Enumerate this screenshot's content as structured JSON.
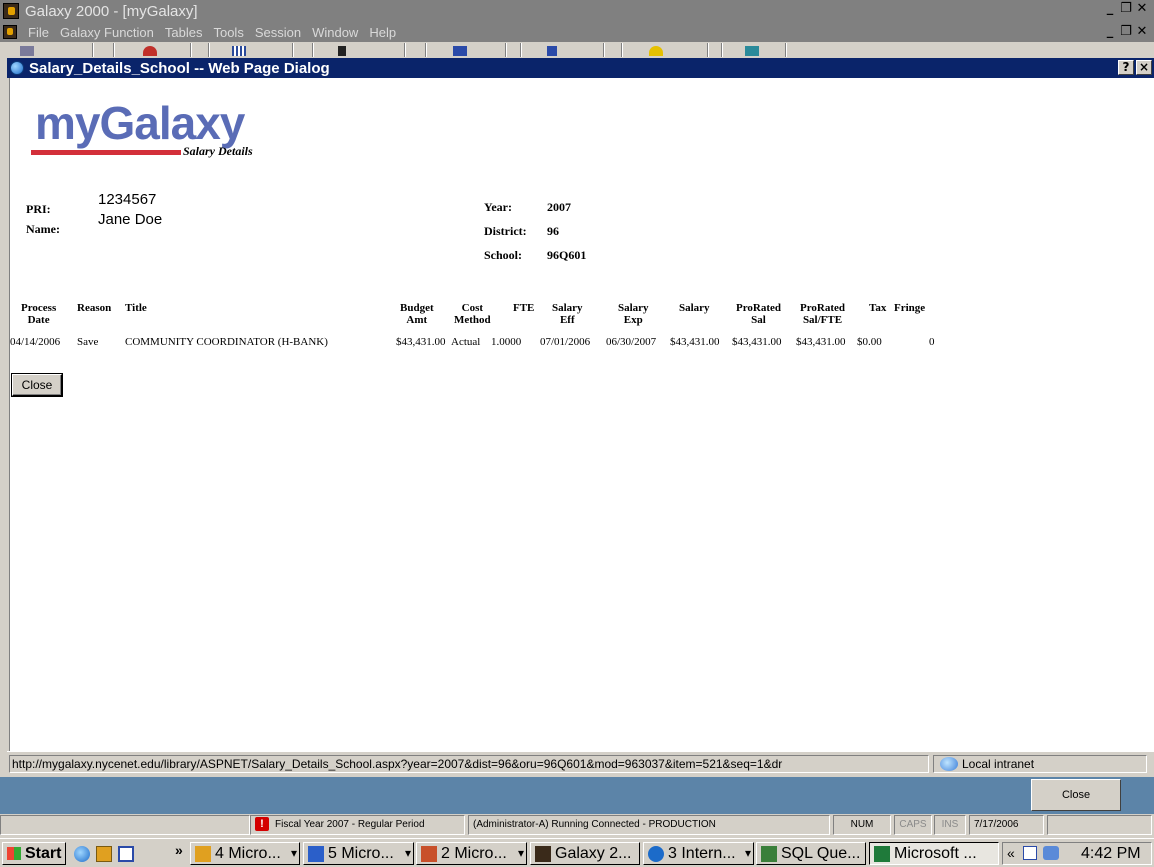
{
  "app": {
    "title": "Galaxy 2000 - [myGalaxy]",
    "menu": [
      "File",
      "Galaxy Function",
      "Tables",
      "Tools",
      "Session",
      "Window",
      "Help"
    ]
  },
  "dialog": {
    "title": "Salary_Details_School -- Web Page Dialog",
    "help_btn": "?",
    "close_btn": "×"
  },
  "logo": {
    "text": "myGalaxy",
    "subtitle": "Salary Details"
  },
  "info": {
    "pri_label": "PRI:",
    "pri_value": "1234567",
    "name_label": "Name:",
    "name_value": "Jane Doe",
    "year_label": "Year:",
    "year_value": "2007",
    "district_label": "District:",
    "district_value": "96",
    "school_label": "School:",
    "school_value": "96Q601"
  },
  "table": {
    "headers": {
      "process_date": "Process\nDate",
      "reason": "Reason",
      "title": "Title",
      "budget_amt": "Budget\nAmt",
      "cost_method": "Cost\nMethod",
      "fte": "FTE",
      "salary_eff": "Salary\nEff",
      "salary_exp": "Salary\nExp",
      "salary": "Salary",
      "prorated_sal": "ProRated\nSal",
      "prorated_sal_fte": "ProRated\nSal/FTE",
      "tax": "Tax",
      "fringe": "Fringe"
    },
    "rows": [
      {
        "process_date": "04/14/2006",
        "reason": "Save",
        "title": "COMMUNITY COORDINATOR (H-BANK)",
        "budget_amt": "$43,431.00",
        "cost_method": "Actual",
        "fte": "1.0000",
        "salary_eff": "07/01/2006",
        "salary_exp": "06/30/2007",
        "salary": "$43,431.00",
        "prorated_sal": "$43,431.00",
        "prorated_sal_fte": "$43,431.00",
        "tax": "$0.00",
        "fringe": "0"
      }
    ]
  },
  "close_button": "Close",
  "ie_status": {
    "url": "http://mygalaxy.nycenet.edu/library/ASPNET/Salary_Details_School.aspx?year=2007&dist=96&oru=96Q601&mod=963037&item=521&seq=1&dr",
    "zone": "Local intranet"
  },
  "galaxy_close": "Close",
  "app_status": {
    "fiscal": "Fiscal Year 2007 - Regular Period",
    "connection": "(Administrator-A) Running Connected - PRODUCTION",
    "num": "NUM",
    "caps": "CAPS",
    "ins": "INS",
    "date": "7/17/2006"
  },
  "taskbar": {
    "start": "Start",
    "chevron": "»",
    "tasks": [
      {
        "label": "4 Micro...",
        "icon": "outlook-icon",
        "color": "#e0a020",
        "dropdown": true
      },
      {
        "label": "5 Micro...",
        "icon": "word-icon",
        "color": "#2b5fc9",
        "dropdown": true
      },
      {
        "label": "2 Micro...",
        "icon": "powerpoint-icon",
        "color": "#c8502a",
        "dropdown": true
      },
      {
        "label": "Galaxy 2...",
        "icon": "galaxy-icon",
        "color": "#3a2a1a",
        "dropdown": false
      },
      {
        "label": "3 Intern...",
        "icon": "ie-icon",
        "color": "#1c6bc9",
        "dropdown": true
      },
      {
        "label": "SQL Que...",
        "icon": "sql-icon",
        "color": "#3a7f3a",
        "dropdown": false
      },
      {
        "label": "Microsoft ...",
        "icon": "excel-icon",
        "color": "#1f7a3a",
        "dropdown": false
      }
    ],
    "tray_chevron": "«",
    "clock": "4:42 PM"
  }
}
